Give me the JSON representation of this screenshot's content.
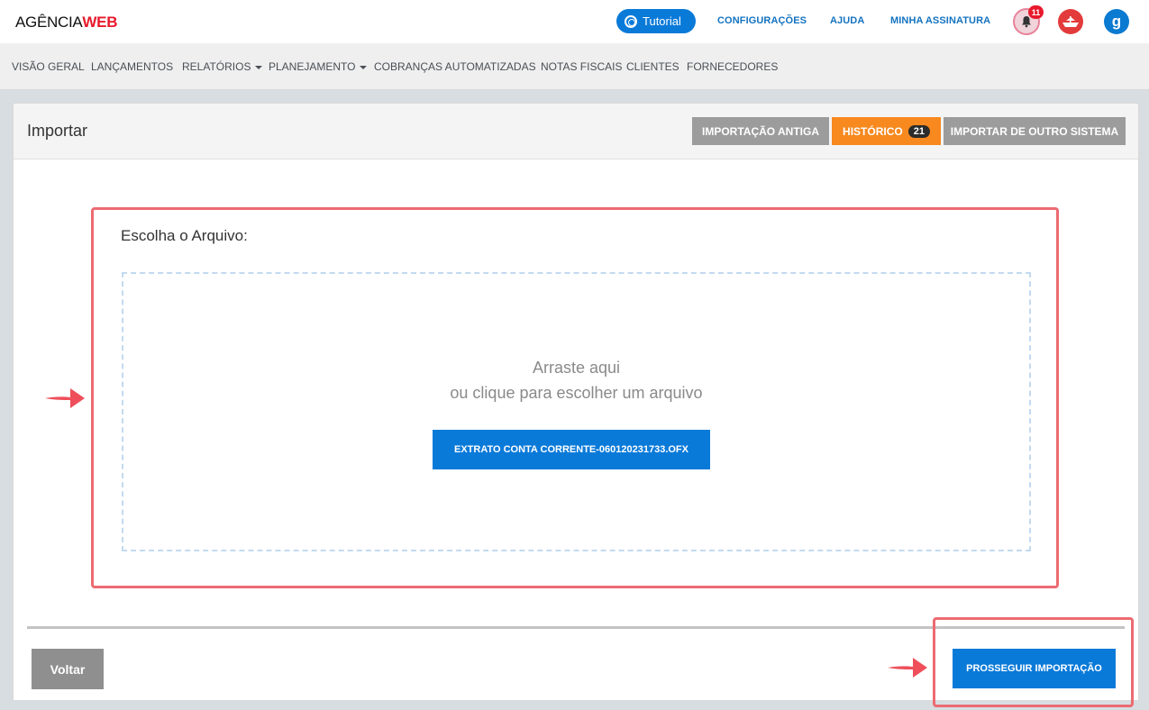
{
  "header": {
    "logo_main": "AGÊNCIA",
    "logo_accent": "WEB",
    "tutorial_label": "Tutorial",
    "links": {
      "config": "CONFIGURAÇÕES",
      "help": "AJUDA",
      "subscription": "MINHA ASSINATURA"
    },
    "notifications_count": "11",
    "profile_initial": "g"
  },
  "nav": {
    "items": [
      {
        "label": "VISÃO GERAL"
      },
      {
        "label": "LANÇAMENTOS"
      },
      {
        "label": "RELATÓRIOS"
      },
      {
        "label": "PLANEJAMENTO"
      },
      {
        "label": "COBRANÇAS AUTOMATIZADAS"
      },
      {
        "label": "NOTAS FISCAIS"
      },
      {
        "label": "CLIENTES"
      },
      {
        "label": "FORNECEDORES"
      }
    ]
  },
  "page": {
    "title": "Importar",
    "buttons": {
      "old_import": "IMPORTAÇÃO ANTIGA",
      "history": "HISTÓRICO",
      "history_count": "21",
      "other_system": "IMPORTAR DE OUTRO SISTEMA"
    },
    "choose_label": "Escolha o Arquivo:",
    "drop_line1": "Arraste aqui",
    "drop_line2": "ou clique para escolher um arquivo",
    "file_name": "EXTRATO CONTA CORRENTE-060120231733.OFX",
    "back_label": "Voltar",
    "proceed_label": "PROSSEGUIR IMPORTAÇÃO"
  },
  "colors": {
    "primary": "#0a7ad9",
    "accent_orange": "#f7891f",
    "highlight_red": "#ec6b72",
    "brand_red": "#e8192c"
  }
}
